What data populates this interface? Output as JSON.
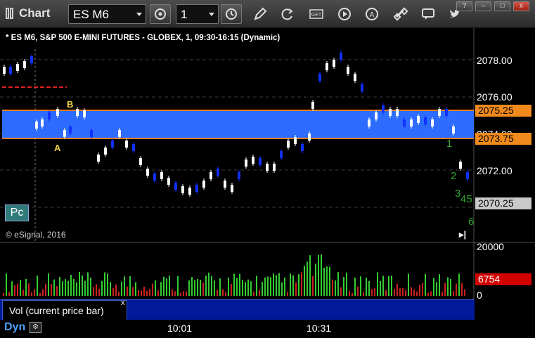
{
  "window": {
    "title": "Chart",
    "symbol": "ES M6",
    "interval": "1",
    "buttons": [
      "?",
      "–",
      "□",
      "x"
    ]
  },
  "chart": {
    "title": "* ES M6, S&P 500 E-MINI FUTURES - GLOBEX, 1, 09:30-16:15 (Dynamic)",
    "watermark": "© eSignal, 2016",
    "pc_badge": "Pc",
    "price_axis": [
      "2078.00",
      "2076.00",
      "2074.00",
      "2072.00"
    ],
    "tags": {
      "upper": "2075.25",
      "lower": "2073.75",
      "last": "2070.25"
    },
    "labels": {
      "a": "A",
      "b": "B",
      "n1": "1",
      "n2": "2",
      "n3": "3",
      "n45": "45",
      "n6": "6"
    },
    "colors": {
      "band": "#2d6cff",
      "band_edge": "#ff7f1f",
      "up_bar": "#ffffff",
      "down_bar": "#1030ff",
      "vol_up": "#33cc33",
      "vol_down": "#cc2020"
    }
  },
  "volume": {
    "axis": [
      "20000",
      "0"
    ],
    "current": "6754",
    "study_label": "Vol (current price bar)",
    "close_glyph": "x"
  },
  "time_axis": {
    "labels": [
      "10:01",
      "10:31"
    ],
    "mode": "Dyn"
  }
}
